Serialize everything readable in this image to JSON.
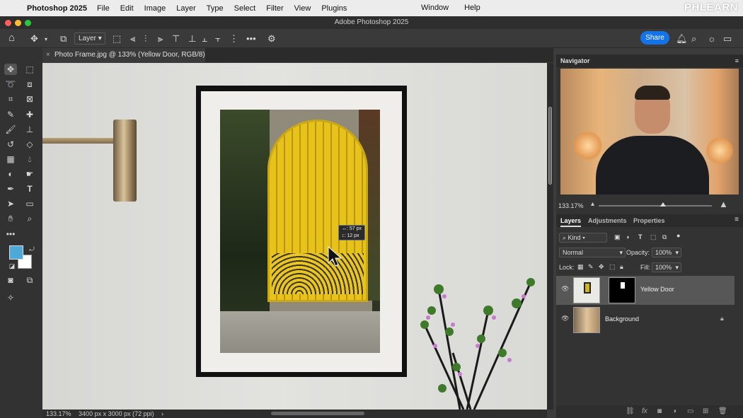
{
  "menubar": {
    "app_name": "Photoshop 2025",
    "items": [
      "File",
      "Edit",
      "Image",
      "Layer",
      "Type",
      "Select",
      "Filter",
      "View",
      "Plugins"
    ],
    "right_items": [
      "Window",
      "Help"
    ],
    "watermark": "PHLEARN"
  },
  "window": {
    "title": "Adobe Photoshop 2025"
  },
  "options_bar": {
    "auto_select_target": "Layer",
    "share_label": "Share"
  },
  "document": {
    "tab_title": "Photo Frame.jpg @ 133% (Yellow Door, RGB/8) *",
    "measure_line1": "↔: 57 px",
    "measure_line2": "↕: 12 px",
    "status_zoom": "133.17%",
    "status_info": "3400 px x 3000 px (72 ppi)"
  },
  "colors": {
    "foreground": "#4ea9d8",
    "background": "#ffffff",
    "accent": "#1473e6"
  },
  "navigator": {
    "title": "Navigator",
    "zoom": "133.17%",
    "zoom_level": 0.57
  },
  "layers_panel": {
    "tabs": [
      "Layers",
      "Adjustments",
      "Properties"
    ],
    "filter_label": "Kind",
    "blend_mode": "Normal",
    "opacity_label": "Opacity:",
    "opacity_value": "100%",
    "lock_label": "Lock:",
    "fill_label": "Fill:",
    "fill_value": "100%",
    "layers": [
      {
        "name": "Yellow Door",
        "selected": true
      },
      {
        "name": "Background",
        "selected": false,
        "locked": true
      }
    ]
  }
}
